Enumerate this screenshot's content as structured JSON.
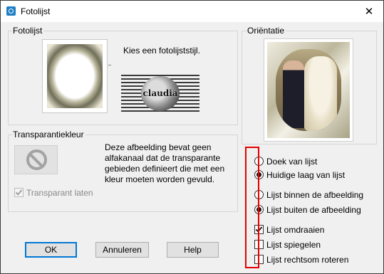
{
  "window": {
    "title": "Fotolijst",
    "close_glyph": "✕"
  },
  "frame_group": {
    "label": "Fotolijst",
    "choose_text": "Kies een fotolijststijl.",
    "logo_text": "claudia"
  },
  "transparency_group": {
    "label": "Transparantiekleur",
    "description": "Deze afbeelding bevat geen alfakanaal dat de transparante gebieden definieert die met een kleur moeten worden gevuld.",
    "checkbox_label": "Transparant laten",
    "checkbox_checked": true,
    "checkbox_disabled": true
  },
  "orientation_group": {
    "label": "Oriëntatie",
    "apply_to": [
      {
        "label": "Doek van lijst",
        "selected": false
      },
      {
        "label": "Huidige laag van lijst",
        "selected": true
      }
    ],
    "placement": [
      {
        "label": "Lijst binnen de afbeelding",
        "selected": false
      },
      {
        "label": "Lijst buiten de afbeelding",
        "selected": true
      }
    ],
    "options": [
      {
        "label": "Lijst omdraaien",
        "checked": true
      },
      {
        "label": "Lijst spiegelen",
        "checked": false
      },
      {
        "label": "Lijst rechtsom roteren",
        "checked": false
      }
    ]
  },
  "buttons": {
    "ok": "OK",
    "cancel": "Annuleren",
    "help": "Help"
  },
  "colors": {
    "highlight": "#e60000",
    "accent": "#0078d7"
  },
  "icons": {
    "app": "frame-app-icon",
    "close": "close-icon",
    "no_transparency": "prohibited-icon"
  }
}
